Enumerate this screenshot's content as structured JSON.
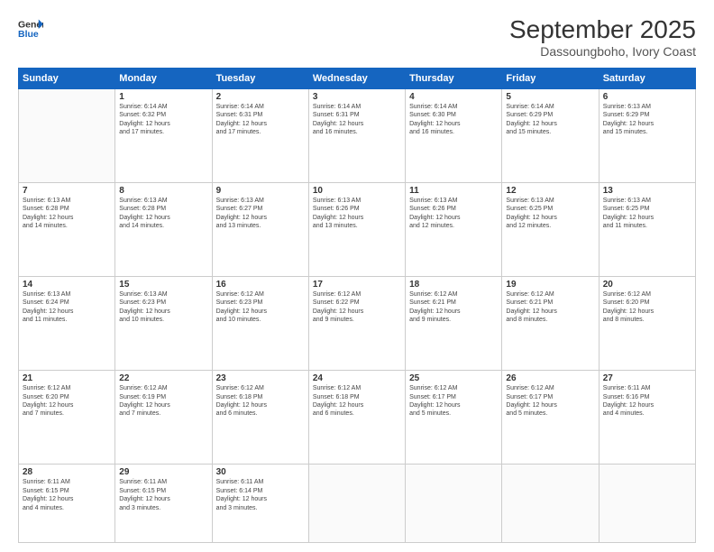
{
  "header": {
    "logo_line1": "General",
    "logo_line2": "Blue",
    "month": "September 2025",
    "location": "Dassoungboho, Ivory Coast"
  },
  "weekdays": [
    "Sunday",
    "Monday",
    "Tuesday",
    "Wednesday",
    "Thursday",
    "Friday",
    "Saturday"
  ],
  "weeks": [
    [
      {
        "day": "",
        "info": ""
      },
      {
        "day": "1",
        "info": "Sunrise: 6:14 AM\nSunset: 6:32 PM\nDaylight: 12 hours\nand 17 minutes."
      },
      {
        "day": "2",
        "info": "Sunrise: 6:14 AM\nSunset: 6:31 PM\nDaylight: 12 hours\nand 17 minutes."
      },
      {
        "day": "3",
        "info": "Sunrise: 6:14 AM\nSunset: 6:31 PM\nDaylight: 12 hours\nand 16 minutes."
      },
      {
        "day": "4",
        "info": "Sunrise: 6:14 AM\nSunset: 6:30 PM\nDaylight: 12 hours\nand 16 minutes."
      },
      {
        "day": "5",
        "info": "Sunrise: 6:14 AM\nSunset: 6:29 PM\nDaylight: 12 hours\nand 15 minutes."
      },
      {
        "day": "6",
        "info": "Sunrise: 6:13 AM\nSunset: 6:29 PM\nDaylight: 12 hours\nand 15 minutes."
      }
    ],
    [
      {
        "day": "7",
        "info": "Sunrise: 6:13 AM\nSunset: 6:28 PM\nDaylight: 12 hours\nand 14 minutes."
      },
      {
        "day": "8",
        "info": "Sunrise: 6:13 AM\nSunset: 6:28 PM\nDaylight: 12 hours\nand 14 minutes."
      },
      {
        "day": "9",
        "info": "Sunrise: 6:13 AM\nSunset: 6:27 PM\nDaylight: 12 hours\nand 13 minutes."
      },
      {
        "day": "10",
        "info": "Sunrise: 6:13 AM\nSunset: 6:26 PM\nDaylight: 12 hours\nand 13 minutes."
      },
      {
        "day": "11",
        "info": "Sunrise: 6:13 AM\nSunset: 6:26 PM\nDaylight: 12 hours\nand 12 minutes."
      },
      {
        "day": "12",
        "info": "Sunrise: 6:13 AM\nSunset: 6:25 PM\nDaylight: 12 hours\nand 12 minutes."
      },
      {
        "day": "13",
        "info": "Sunrise: 6:13 AM\nSunset: 6:25 PM\nDaylight: 12 hours\nand 11 minutes."
      }
    ],
    [
      {
        "day": "14",
        "info": "Sunrise: 6:13 AM\nSunset: 6:24 PM\nDaylight: 12 hours\nand 11 minutes."
      },
      {
        "day": "15",
        "info": "Sunrise: 6:13 AM\nSunset: 6:23 PM\nDaylight: 12 hours\nand 10 minutes."
      },
      {
        "day": "16",
        "info": "Sunrise: 6:12 AM\nSunset: 6:23 PM\nDaylight: 12 hours\nand 10 minutes."
      },
      {
        "day": "17",
        "info": "Sunrise: 6:12 AM\nSunset: 6:22 PM\nDaylight: 12 hours\nand 9 minutes."
      },
      {
        "day": "18",
        "info": "Sunrise: 6:12 AM\nSunset: 6:21 PM\nDaylight: 12 hours\nand 9 minutes."
      },
      {
        "day": "19",
        "info": "Sunrise: 6:12 AM\nSunset: 6:21 PM\nDaylight: 12 hours\nand 8 minutes."
      },
      {
        "day": "20",
        "info": "Sunrise: 6:12 AM\nSunset: 6:20 PM\nDaylight: 12 hours\nand 8 minutes."
      }
    ],
    [
      {
        "day": "21",
        "info": "Sunrise: 6:12 AM\nSunset: 6:20 PM\nDaylight: 12 hours\nand 7 minutes."
      },
      {
        "day": "22",
        "info": "Sunrise: 6:12 AM\nSunset: 6:19 PM\nDaylight: 12 hours\nand 7 minutes."
      },
      {
        "day": "23",
        "info": "Sunrise: 6:12 AM\nSunset: 6:18 PM\nDaylight: 12 hours\nand 6 minutes."
      },
      {
        "day": "24",
        "info": "Sunrise: 6:12 AM\nSunset: 6:18 PM\nDaylight: 12 hours\nand 6 minutes."
      },
      {
        "day": "25",
        "info": "Sunrise: 6:12 AM\nSunset: 6:17 PM\nDaylight: 12 hours\nand 5 minutes."
      },
      {
        "day": "26",
        "info": "Sunrise: 6:12 AM\nSunset: 6:17 PM\nDaylight: 12 hours\nand 5 minutes."
      },
      {
        "day": "27",
        "info": "Sunrise: 6:11 AM\nSunset: 6:16 PM\nDaylight: 12 hours\nand 4 minutes."
      }
    ],
    [
      {
        "day": "28",
        "info": "Sunrise: 6:11 AM\nSunset: 6:15 PM\nDaylight: 12 hours\nand 4 minutes."
      },
      {
        "day": "29",
        "info": "Sunrise: 6:11 AM\nSunset: 6:15 PM\nDaylight: 12 hours\nand 3 minutes."
      },
      {
        "day": "30",
        "info": "Sunrise: 6:11 AM\nSunset: 6:14 PM\nDaylight: 12 hours\nand 3 minutes."
      },
      {
        "day": "",
        "info": ""
      },
      {
        "day": "",
        "info": ""
      },
      {
        "day": "",
        "info": ""
      },
      {
        "day": "",
        "info": ""
      }
    ]
  ]
}
